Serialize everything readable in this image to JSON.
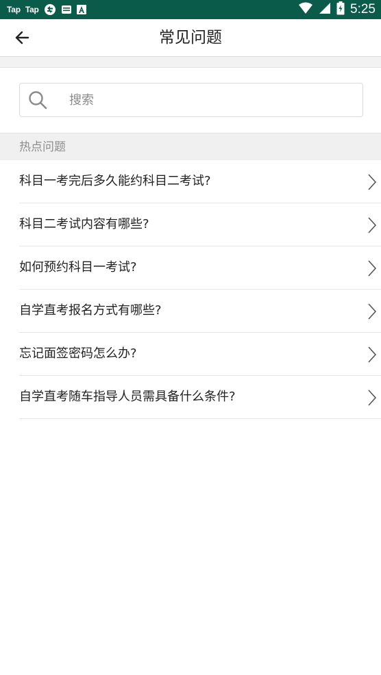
{
  "status_bar": {
    "app_labels": [
      "Tap",
      "Tap"
    ],
    "time": "5:25",
    "background_color": "#0b5b4b",
    "icons": [
      "taptap-icon",
      "taptap-icon",
      "sync-icon",
      "message-icon",
      "font-icon",
      "wifi-icon",
      "signal-icon",
      "battery-icon"
    ]
  },
  "header": {
    "title": "常见问题",
    "back_icon": "arrow-left-icon"
  },
  "search": {
    "placeholder": "搜索",
    "value": "",
    "icon": "search-icon"
  },
  "section": {
    "title": "热点问题"
  },
  "faq": {
    "items": [
      {
        "label": "科目一考完后多久能约科目二考试?"
      },
      {
        "label": "科目二考试内容有哪些?"
      },
      {
        "label": "如何预约科目一考试?"
      },
      {
        "label": "自学直考报名方式有哪些?"
      },
      {
        "label": "忘记面签密码怎么办?"
      },
      {
        "label": "自学直考随车指导人员需具备什么条件?"
      }
    ],
    "chevron_icon": "chevron-right-icon"
  }
}
